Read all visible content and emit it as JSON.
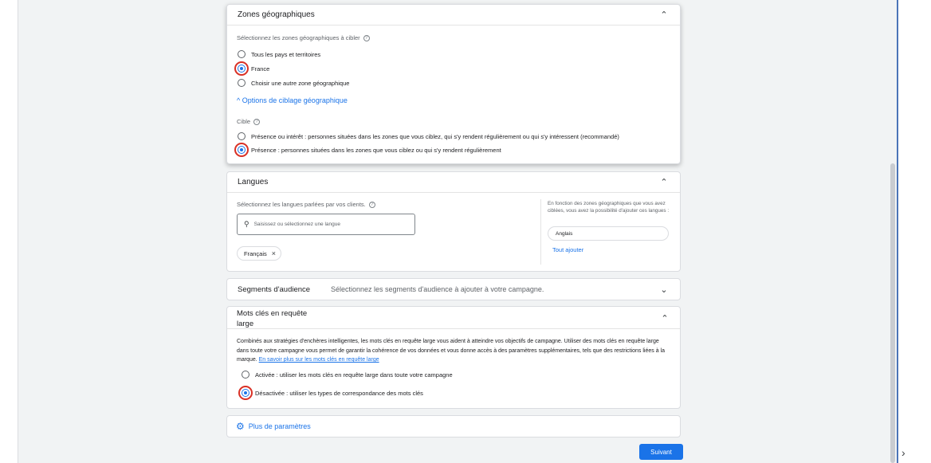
{
  "geo": {
    "title": "Zones géographiques",
    "select_label": "Sélectionnez les zones géographiques à cibler",
    "options": [
      "Tous les pays et territoires",
      "France",
      "Choisir une autre zone géographique"
    ],
    "selected_option": "France",
    "targeting_toggle": "Options de ciblage géographique",
    "target_label": "Cible",
    "target_options": [
      "Présence ou intérêt : personnes situées dans les zones que vous ciblez, qui s'y rendent régulièrement ou qui s'y intéressent (recommandé)",
      "Présence : personnes situées dans les zones que vous ciblez ou qui s'y rendent régulièrement"
    ],
    "selected_target": "Présence : personnes situées dans les zones que vous ciblez ou qui s'y rendent régulièrement"
  },
  "languages": {
    "title": "Langues",
    "select_label": "Sélectionnez les langues parlées par vos clients.",
    "search_placeholder": "Saisissez ou sélectionnez une langue",
    "chips": [
      "Français"
    ],
    "suggest_text": "En fonction des zones géographiques que vous avez ciblées, vous avez la possibilité d'ajouter ces langues :",
    "suggested": [
      "Anglais"
    ],
    "add_all": "Tout ajouter"
  },
  "audience": {
    "title": "Segments d'audience",
    "summary": "Sélectionnez les segments d'audience à ajouter à votre campagne."
  },
  "broad": {
    "title_line1": "Mots clés en requête",
    "title_line2": "large",
    "description": "Combinés aux stratégies d'enchères intelligentes, les mots clés en requête large vous aident à atteindre vos objectifs de campagne. Utiliser des mots clés en requête large dans toute votre campagne vous permet de garantir la cohérence de vos données et vous donne accès à des paramètres supplémentaires, tels que des restrictions liées à la marque.",
    "learn_more": "En savoir plus sur les mots clés en requête large",
    "options": [
      "Activée : utiliser les mots clés en requête large dans toute votre campagne",
      "Désactivée : utiliser les types de correspondance des mots clés"
    ],
    "selected_option": "Désactivée : utiliser les types de correspondance des mots clés"
  },
  "more_settings": "Plus de paramètres",
  "next_button": "Suivant",
  "colors": {
    "accent": "#1a73e8",
    "highlight_ring": "#d93025",
    "background": "#f1f3f4"
  },
  "icons": [
    "chevron-up-icon",
    "chevron-down-icon",
    "help-icon",
    "search-icon",
    "close-icon",
    "gear-icon",
    "chevron-right-icon"
  ]
}
